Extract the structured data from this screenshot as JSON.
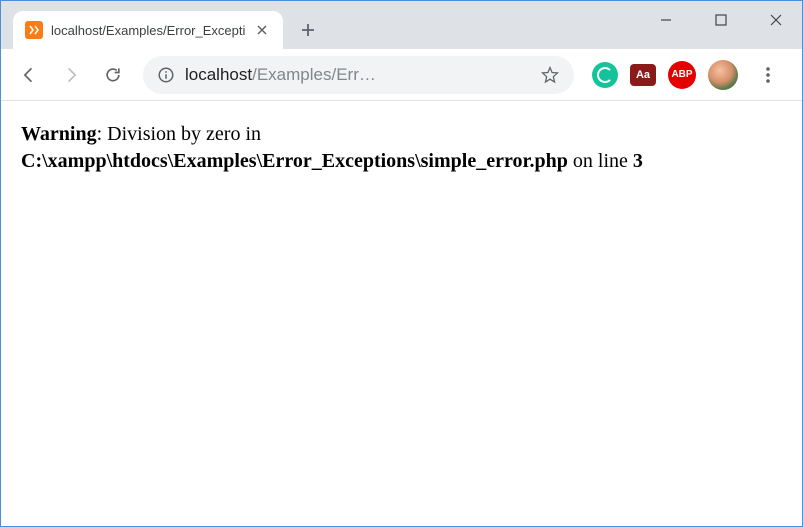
{
  "tab": {
    "title": "localhost/Examples/Error_Excepti"
  },
  "omnibox": {
    "host": "localhost",
    "path": "/Examples/Err…"
  },
  "extensions": {
    "dict_label": "Aa",
    "abp_label": "ABP"
  },
  "page": {
    "warning_label": "Warning",
    "warning_msg": ": Division by zero in ",
    "file_path": "C:\\xampp\\htdocs\\Examples\\Error_Exceptions\\simple_error.php",
    "on_line": " on line ",
    "line_no": "3"
  }
}
